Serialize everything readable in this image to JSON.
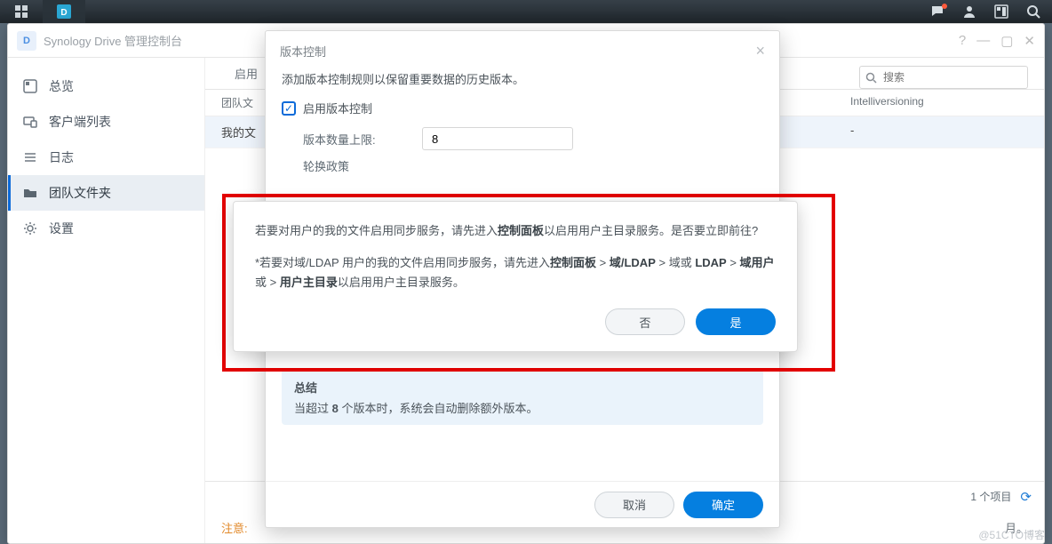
{
  "sysbar": {
    "icons_right": [
      "chat",
      "user",
      "dashboard",
      "search"
    ]
  },
  "app": {
    "title": "Synology Drive 管理控制台",
    "logo_text": "D",
    "window_controls": {
      "help": "?",
      "min": "—",
      "max": "▢",
      "close": "✕"
    }
  },
  "sidebar": {
    "items": [
      {
        "icon": "overview",
        "label": "总览"
      },
      {
        "icon": "clients",
        "label": "客户端列表"
      },
      {
        "icon": "logs",
        "label": "日志"
      },
      {
        "icon": "teamfolder",
        "label": "团队文件夹"
      },
      {
        "icon": "settings",
        "label": "设置"
      }
    ],
    "active_index": 3
  },
  "tabs": {
    "items": [
      "启用"
    ],
    "search_placeholder": "搜索"
  },
  "table": {
    "headers": {
      "c1": "团队文",
      "c2": "Intelliversioning"
    },
    "rows": [
      {
        "c1": "我的文",
        "c2": "-",
        "selected": true
      }
    ]
  },
  "footer": {
    "count_label": "1 个项目"
  },
  "note": {
    "label": "注意:",
    "end_text": "月。"
  },
  "modal_version": {
    "title": "版本控制",
    "desc": "添加版本控制规则以保留重要数据的历史版本。",
    "enable_label": "启用版本控制",
    "max_label": "版本数量上限:",
    "max_value": "8",
    "policy_label": "轮换政策",
    "summary_title": "总结",
    "summary_text_prefix": "当超过 ",
    "summary_text_bold": "8",
    "summary_text_suffix": " 个版本时，系统会自动删除额外版本。",
    "cancel": "取消",
    "ok": "确定"
  },
  "modal_confirm": {
    "p1_a": "若要对用户的我的文件启用同步服务，请先进入",
    "p1_b": "控制面板",
    "p1_c": "以启用用户主目录服务。是否要立即前往?",
    "p2_a": "*若要对域/LDAP 用户的我的文件启用同步服务，请先进入",
    "p2_b": "控制面板",
    "p2_c": " > ",
    "p2_d": "域/LDAP",
    "p2_e": " > 域或 ",
    "p2_f": "LDAP",
    "p2_g": " > ",
    "p2_h": "域用户",
    "p2_i": "或 > ",
    "p2_j": "用户主目录",
    "p2_k": "以启用用户主目录服务。",
    "no": "否",
    "yes": "是"
  },
  "watermark": "@51CTO博客"
}
